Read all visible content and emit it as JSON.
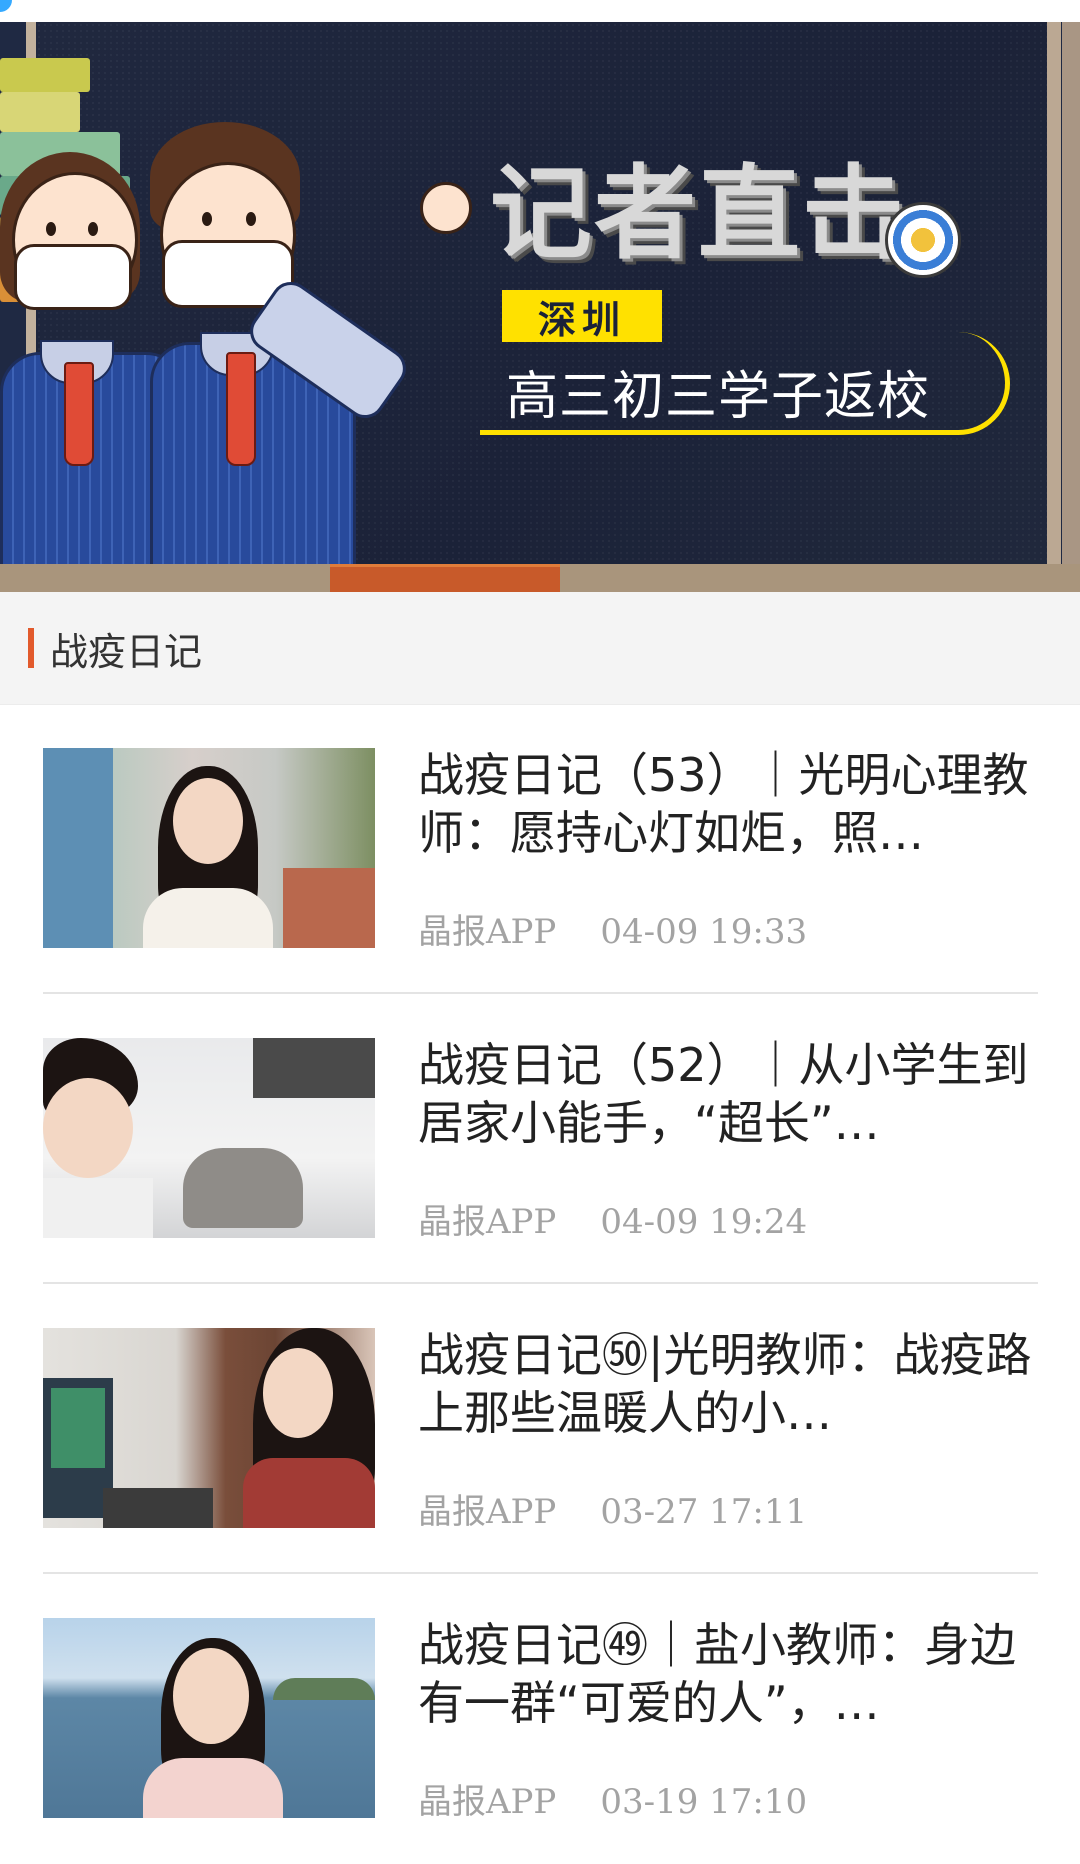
{
  "banner": {
    "title": "记者直击",
    "tag": "深圳",
    "subtitle": "高三初三学子返校"
  },
  "section": {
    "title": "战疫日记"
  },
  "articles": [
    {
      "title": "战疫日记（53）｜光明心理教师：愿持心灯如炬，照…",
      "source": "晶报APP",
      "date": "04-09",
      "time": "19:33"
    },
    {
      "title": "战疫日记（52）｜从小学生到居家小能手，“超长”…",
      "source": "晶报APP",
      "date": "04-09",
      "time": "19:24"
    },
    {
      "title": "战疫日记㊿|光明教师：战疫路上那些温暖人的小…",
      "source": "晶报APP",
      "date": "03-27",
      "time": "17:11"
    },
    {
      "title": "战疫日记㊾｜盐小教师：身边有一群“可爱的人”，…",
      "source": "晶报APP",
      "date": "03-19",
      "time": "17:10"
    }
  ],
  "colors": {
    "accent": "#e25a2c",
    "banner_yellow": "#ffe100",
    "meta_gray": "#a3a3a3"
  }
}
